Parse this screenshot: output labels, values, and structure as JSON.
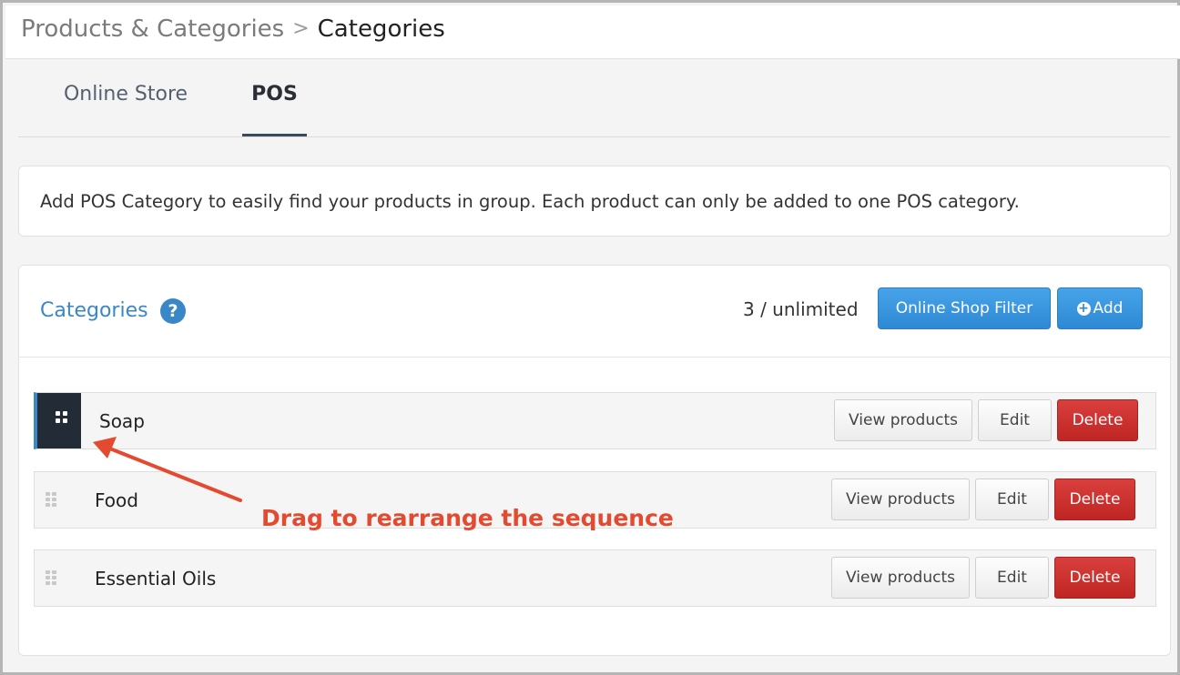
{
  "breadcrumb": {
    "parent": "Products & Categories",
    "separator": ">",
    "current": "Categories"
  },
  "tabs": [
    {
      "label": "Online Store",
      "active": false
    },
    {
      "label": "POS",
      "active": true
    }
  ],
  "info": {
    "text": "Add POS Category to easily find your products in group. Each product can only be added to one POS category."
  },
  "panel": {
    "title": "Categories",
    "help_icon": "question-circle-icon",
    "help_glyph": "?",
    "count": "3 / unlimited",
    "filter_button": "Online Shop Filter",
    "add_button": "Add",
    "add_icon_glyph": "+"
  },
  "categories": [
    {
      "name": "Soap",
      "view_label": "View products",
      "edit_label": "Edit",
      "delete_label": "Delete",
      "dragging": true
    },
    {
      "name": "Food",
      "view_label": "View products",
      "edit_label": "Edit",
      "delete_label": "Delete",
      "dragging": false
    },
    {
      "name": "Essential Oils",
      "view_label": "View products",
      "edit_label": "Edit",
      "delete_label": "Delete",
      "dragging": false
    }
  ],
  "annotation": {
    "text": "Drag to rearrange the sequence"
  },
  "colors": {
    "accent_blue": "#3a87c8",
    "delete_red": "#c9302c",
    "annotation_red": "#e44a30",
    "drag_handle_dark": "#232b36"
  }
}
